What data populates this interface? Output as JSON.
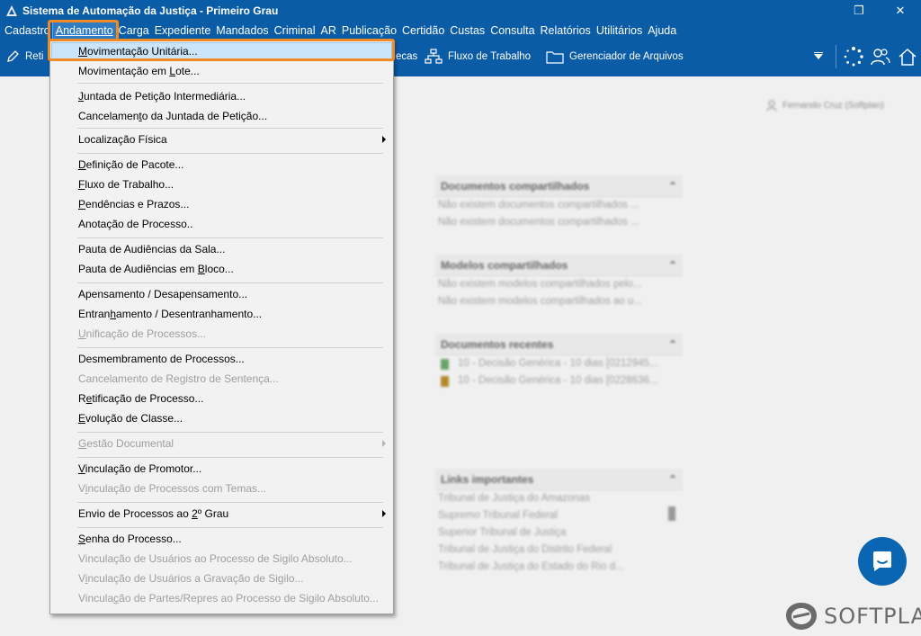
{
  "window": {
    "title": "Sistema de Automação da Justiça - Primeiro Grau",
    "restore_glyph": "❐",
    "close_glyph": "✕"
  },
  "menubar": [
    {
      "label": "Cadastro"
    },
    {
      "label": "Andamento"
    },
    {
      "label": "Carga"
    },
    {
      "label": "Expediente"
    },
    {
      "label": "Mandados"
    },
    {
      "label": "Criminal"
    },
    {
      "label": "AR"
    },
    {
      "label": "Publicação"
    },
    {
      "label": "Certidão"
    },
    {
      "label": "Custas"
    },
    {
      "label": "Consulta"
    },
    {
      "label": "Relatórios"
    },
    {
      "label": "Utilitários"
    },
    {
      "label": "Ajuda"
    }
  ],
  "toolbar": {
    "partial_left": "Reti",
    "partial_mid": "ecas",
    "flow": "Fluxo de Trabalho",
    "files": "Gerenciador de Arquivos"
  },
  "dropdown": {
    "items": [
      {
        "pre": "",
        "u": "M",
        "post": "ovimentação Unitária..."
      },
      {
        "pre": "Movimentação em ",
        "u": "L",
        "post": "ote..."
      },
      {
        "pre": "",
        "u": "J",
        "post": "untada de Petição Intermediária..."
      },
      {
        "pre": "Cancelamen",
        "u": "t",
        "post": "o da Juntada de Petição..."
      },
      {
        "pre": "Localização Física",
        "u": "",
        "post": ""
      },
      {
        "pre": "",
        "u": "D",
        "post": "efinição de Pacote..."
      },
      {
        "pre": "",
        "u": "F",
        "post": "luxo de Trabalho..."
      },
      {
        "pre": "",
        "u": "P",
        "post": "endências e Prazos..."
      },
      {
        "pre": "Anotação de Processo..",
        "u": "",
        "post": ""
      },
      {
        "pre": "Pauta de Audiências da Sala...",
        "u": "",
        "post": ""
      },
      {
        "pre": "Pauta de Audiências em ",
        "u": "B",
        "post": "loco..."
      },
      {
        "pre": "Apensamento / Desapensamento...",
        "u": "",
        "post": ""
      },
      {
        "pre": "Entran",
        "u": "h",
        "post": "amento / Desentranhamento..."
      },
      {
        "pre": "",
        "u": "U",
        "post": "nificação de Processos..."
      },
      {
        "pre": "Desmembramento de Processos...",
        "u": "",
        "post": ""
      },
      {
        "pre": "Cancelamento de Registro de Sentença...",
        "u": "",
        "post": ""
      },
      {
        "pre": "R",
        "u": "e",
        "post": "tificação de Processo..."
      },
      {
        "pre": "",
        "u": "E",
        "post": "volução de Classe..."
      },
      {
        "pre": "",
        "u": "G",
        "post": "estão Documental"
      },
      {
        "pre": "",
        "u": "V",
        "post": "inculação de Promotor..."
      },
      {
        "pre": "V",
        "u": "i",
        "post": "nculação de Processos com Temas..."
      },
      {
        "pre": "Envio de Processos ao ",
        "u": "2",
        "post": "º Grau"
      },
      {
        "pre": "",
        "u": "S",
        "post": "enha do Processo..."
      },
      {
        "pre": "Vinculação de Usuários ao Processo de Sigilo Absoluto...",
        "u": "",
        "post": ""
      },
      {
        "pre": "V",
        "u": "i",
        "post": "nculação de Usuários a Gravação de Sigilo..."
      },
      {
        "pre": "Vincula",
        "u": "ç",
        "post": "ão de Partes/Repres ao Processo de Sigilo Absoluto..."
      }
    ]
  },
  "background": {
    "user": "Fernando Cruz (Softplan)",
    "shared_docs_title": "Documentos compartilhados",
    "shared_docs_lines": [
      "Não existem documentos compartilhados ...",
      "Não existem documentos compartilhados ..."
    ],
    "shared_models_title": "Modelos compartilhados",
    "shared_models_lines": [
      "Não existem modelos compartilhados pelo...",
      "Não existem modelos compartilhados ao u..."
    ],
    "recent_docs_title": "Documentos recentes",
    "recent_docs_lines": [
      "10 - Decisão Genérica - 10 dias [0212945...",
      "10 - Decisão Genérica - 10 dias [0228636..."
    ],
    "links_title": "Links importantes",
    "links": [
      "Tribunal de Justiça do Amazonas",
      "Supremo Tribunal Federal",
      "Superior Tribunal de Justiça",
      "Tribunal de Justiça do Distrito Federal",
      "Tribunal de Justiça do Estado do Rio d..."
    ]
  },
  "brand": {
    "name": "SOFTPLAN"
  },
  "colors": {
    "titlebar": "#0a5ca6",
    "highlight_box": "#f08a24",
    "menu_hover": "#cce4f7",
    "chat": "#0a66b2"
  }
}
